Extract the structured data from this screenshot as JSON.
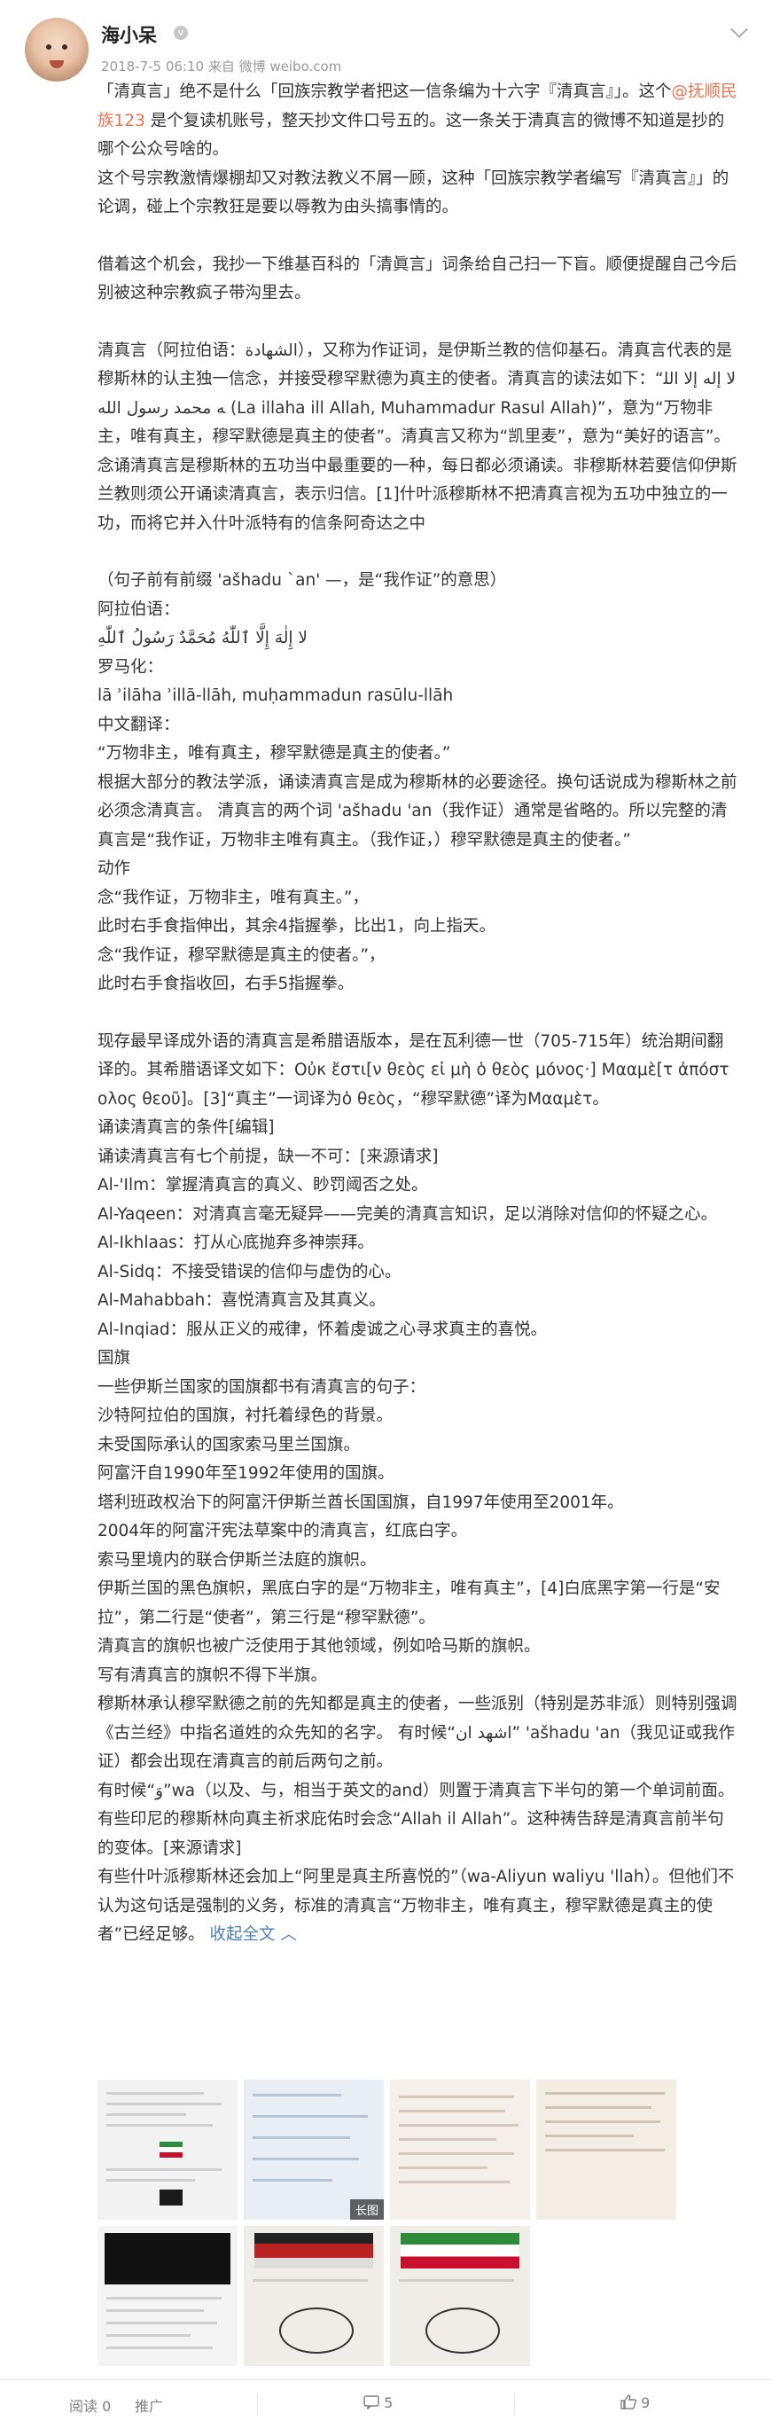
{
  "user": {
    "name": "海小呆",
    "meta": "2018-7-5 06:10 来自 微博 weibo.com"
  },
  "post": {
    "p1a": "「清真言」绝不是什么「回族宗教学者把这一信条编为十六字『清真言』」。这个",
    "mention": "@抚顺民族123",
    "p1b": " 是个复读机账号，整天抄文件口号五的。这一条关于清真言的微博不知道是抄的哪个公众号啥的。",
    "p2": "这个号宗教激情爆棚却又对教法教义不屑一顾，这种「回族宗教学者编写『清真言』」的论调，碰上个宗教狂是要以辱教为由头搞事情的。",
    "p3": "借着这个机会，我抄一下维基百科的「清眞言」词条给自己扫一下盲。顺便提醒自己今后别被这种宗教疯子带沟里去。",
    "p4": "清真言（阿拉伯语：الشهادة），又称为作证词，是伊斯兰教的信仰基石。清真言代表的是穆斯林的认主独一信念，并接受穆罕默德为真主的使者。清真言的读法如下：“لا إله إلا الله محمد رسول الله (La illaha ill Allah, Muhammadur Rasul Allah)”，意为“万物非主，唯有真主，穆罕默德是真主的使者”。清真言又称为“凯里麦”，意为“美好的语言”。念诵清真言是穆斯林的五功当中最重要的一种，每日都必须诵读。非穆斯林若要信仰伊斯兰教则须公开诵读清真言，表示归信。[1]什叶派穆斯林不把清真言视为五功中独立的一功，而将它并入什叶派特有的信条阿奇达之中",
    "lines": [
      "（句子前有前缀 'ašhadu `an' —，是“我作证”的意思）",
      "阿拉伯语：",
      "لا إِلٰهَ إِلَّا ٱللّٰهُ مُحَمَّدٌ رَسُولُ ٱللّٰهِ",
      "罗马化：",
      "lā ʾilāha ʾillā-llāh, muḥammadun rasūlu-llāh",
      "中文翻译：",
      "“万物非主，唯有真主，穆罕默德是真主的使者。”",
      "根据大部分的教法学派，诵读清真言是成为穆斯林的必要途径。换句话说成为穆斯林之前必须念清真言。 清真言的两个词 'ašhadu 'an（我作证）通常是省略的。所以完整的清真言是“我作证，万物非主唯有真主。（我作证，）穆罕默德是真主的使者。”",
      "动作",
      "念“我作证，万物非主，唯有真主。”，",
      "此时右手食指伸出，其余4指握拳，比出1，向上指天。",
      "念“我作证，穆罕默德是真主的使者。”，",
      "此时右手食指收回，右手5指握拳。"
    ],
    "lines2": [
      "现存最早译成外语的清真言是希腊语版本，是在瓦利德一世（705-715年）统治期间翻译的。其希腊语译文如下：Οὐκ ἔστι[ν θεὸς εἰ μὴ ὁ θεὸς μόνος·] Μααμὲ[τ ἀπόστολος θεοῦ]。[3]“真主”一词译为ὁ θεὸς，“穆罕默德”译为Μααμὲτ。",
      "诵读清真言的条件[编辑]",
      "诵读清真言有七个前提，缺一不可：[来源请求]",
      "Al-'Ilm：掌握清真言的真义、眇罚阈否之处。",
      "Al-Yaqeen：对清真言毫无疑异——完美的清真言知识，足以消除对信仰的怀疑之心。",
      "Al-Ikhlaas：打从心底抛弃多神崇拜。",
      "Al-Sidq：不接受错误的信仰与虚伪的心。",
      "Al-Mahabbah：喜悦清真言及其真义。",
      "Al-Inqiad：服从正义的戒律，怀着虔诚之心寻求真主的喜悦。",
      "国旗",
      "一些伊斯兰国家的国旗都书有清真言的句子：",
      "沙特阿拉伯的国旗，衬托着绿色的背景。",
      "未受国际承认的国家索马里兰国旗。",
      "阿富汗自1990年至1992年使用的国旗。",
      "塔利班政权治下的阿富汗伊斯兰酋长国国旗，自1997年使用至2001年。",
      "2004年的阿富汗宪法草案中的清真言，红底白字。",
      "索马里境内的联合伊斯兰法庭的旗帜。",
      "伊斯兰国的黑色旗帜，黑底白字的是“万物非主，唯有真主”，[4]白底黑字第一行是“安拉”，第二行是“使者”，第三行是“穆罕默德”。",
      "清真言的旗帜也被广泛使用于其他领域，例如哈马斯的旗帜。",
      "写有清真言的旗帜不得下半旗。",
      "穆斯林承认穆罕默德之前的先知都是真主的使者，一些派别（特别是苏非派）则特别强调《古兰经》中指名道姓的众先知的名字。 有时候“اشهد ان” 'ašhadu 'an（我见证或我作证）都会出现在清真言的前后两句之前。",
      "有时候“وَ”wa（以及、与，相当于英文的and）则置于清真言下半句的第一个单词前面。",
      "有些印尼的穆斯林向真主祈求庇佑时会念“Allah il Allah”。这种祷告辞是清真言前半句的变体。[来源请求]",
      "有些什叶派穆斯林还会加上“阿里是真主所喜悦的”（wa-Aliyun waliyu 'llah）。但他们不认为这句话是强制的义务，标准的清真言“万物非主，唯有真主，穆罕默德是真主的使者”已经足够。"
    ],
    "collapse": "收起全文",
    "long_tag": "长图"
  },
  "footer": {
    "read": "阅读 0",
    "promote": "推广",
    "comments": "5",
    "likes": "9"
  }
}
